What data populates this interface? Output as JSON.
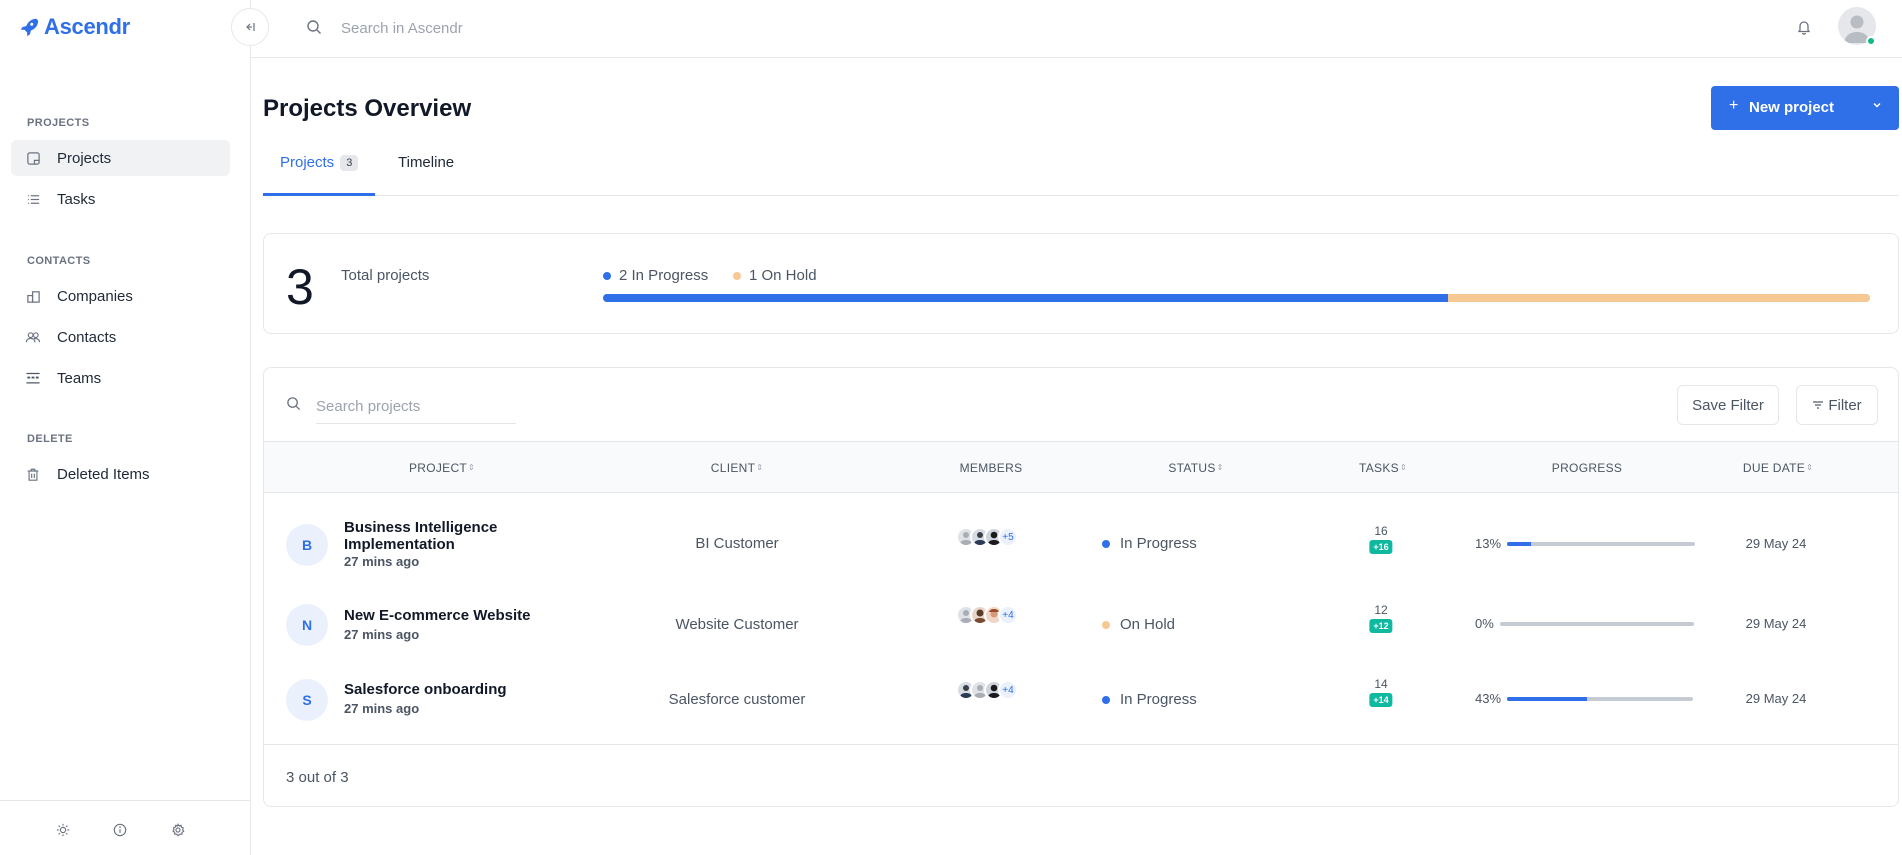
{
  "app": {
    "name": "Ascendr"
  },
  "topbar": {
    "search_placeholder": "Search in Ascendr"
  },
  "sidebar": {
    "sections": [
      {
        "title": "PROJECTS",
        "items": [
          {
            "label": "Projects",
            "icon": "projects-icon",
            "active": true
          },
          {
            "label": "Tasks",
            "icon": "list-icon"
          }
        ]
      },
      {
        "title": "CONTACTS",
        "items": [
          {
            "label": "Companies",
            "icon": "building-icon"
          },
          {
            "label": "Contacts",
            "icon": "users-icon"
          },
          {
            "label": "Teams",
            "icon": "teams-icon"
          }
        ]
      },
      {
        "title": "DELETE",
        "items": [
          {
            "label": "Deleted Items",
            "icon": "trash-icon"
          }
        ]
      }
    ]
  },
  "page": {
    "title": "Projects Overview",
    "new_project_label": "New project",
    "tabs": [
      {
        "label": "Projects",
        "count": "3",
        "active": true
      },
      {
        "label": "Timeline"
      }
    ]
  },
  "summary": {
    "total": "3",
    "total_label": "Total projects",
    "legend": [
      {
        "label": "2 In Progress",
        "color": "#2f6fe8",
        "count": 2
      },
      {
        "label": "1 On Hold",
        "color": "#f5c894",
        "count": 1
      }
    ]
  },
  "table": {
    "search_placeholder": "Search projects",
    "save_filter_label": "Save Filter",
    "filter_label": "Filter",
    "columns": [
      "PROJECT",
      "CLIENT",
      "MEMBERS",
      "STATUS",
      "TASKS",
      "PROGRESS",
      "DUE DATE"
    ],
    "rows": [
      {
        "initial": "B",
        "name": "Business Intelligence Implementation",
        "time": "27 mins ago",
        "client": "BI Customer",
        "members_more": "+5",
        "status": "In Progress",
        "status_color": "#2f6fe8",
        "tasks": "16",
        "tasks_badge": "+16",
        "progress_label": "13%",
        "progress": 0.13,
        "due": "29 May 24"
      },
      {
        "initial": "N",
        "name": "New E-commerce Website",
        "time": "27 mins ago",
        "client": "Website Customer",
        "members_more": "+4",
        "status": "On Hold",
        "status_color": "#f5c894",
        "tasks": "12",
        "tasks_badge": "+12",
        "progress_label": "0%",
        "progress": 0,
        "due": "29 May 24"
      },
      {
        "initial": "S",
        "name": "Salesforce onboarding",
        "time": "27 mins ago",
        "client": "Salesforce customer",
        "members_more": "+4",
        "status": "In Progress",
        "status_color": "#2f6fe8",
        "tasks": "14",
        "tasks_badge": "+14",
        "progress_label": "43%",
        "progress": 0.43,
        "due": "29 May 24"
      }
    ],
    "footer": "3 out of 3"
  }
}
